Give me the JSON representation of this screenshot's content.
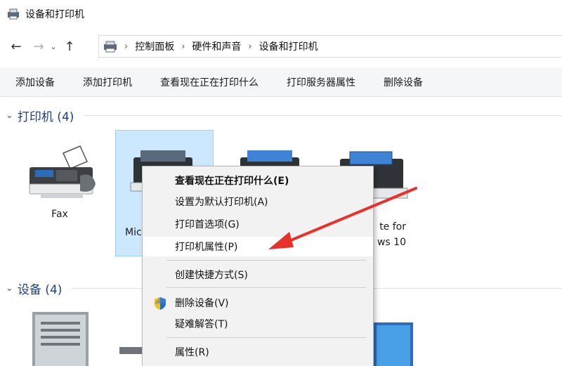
{
  "window": {
    "title": "设备和打印机"
  },
  "breadcrumb": {
    "items": [
      "控制面板",
      "硬件和声音",
      "设备和打印机"
    ]
  },
  "commands": [
    "添加设备",
    "添加打印机",
    "查看现在正在打印什么",
    "打印服务器属性",
    "删除设备"
  ],
  "printers_group": {
    "label": "打印机 (4)"
  },
  "devices_group": {
    "label": "设备 (4)"
  },
  "printers": [
    {
      "name": "Fax"
    },
    {
      "name": "Mic"
    },
    {
      "name": ""
    },
    {
      "name": "te for",
      "name2": "ws 10"
    }
  ],
  "context_menu": {
    "items": [
      {
        "label": "查看现在正在打印什么(E)",
        "bold": true
      },
      {
        "label": "设置为默认打印机(A)"
      },
      {
        "label": "打印首选项(G)"
      },
      {
        "label": "打印机属性(P)",
        "highlighted": true
      },
      {
        "label": "创建快捷方式(S)"
      },
      {
        "label": "删除设备(V)",
        "icon": "shield-icon"
      },
      {
        "label": "疑难解答(T)"
      },
      {
        "label": "属性(R)"
      }
    ]
  },
  "colors": {
    "group_header": "#1e3f8a",
    "selection": "#cce8ff",
    "arrow": "#e8312a"
  }
}
